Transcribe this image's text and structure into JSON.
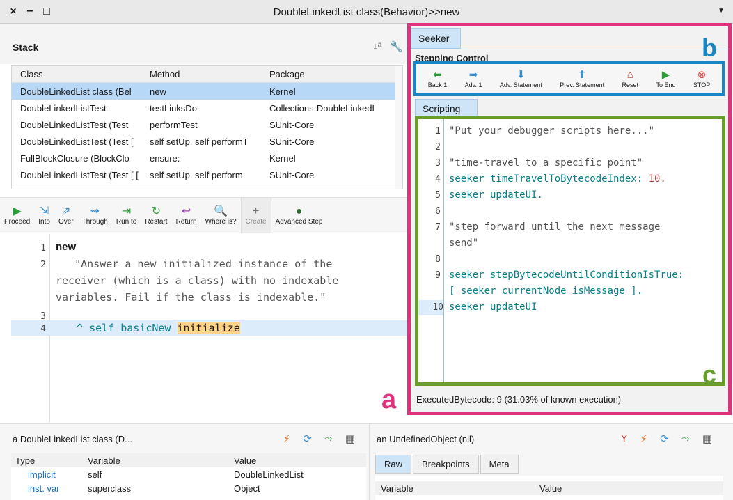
{
  "window": {
    "title": "DoubleLinkedList class(Behavior)>>new",
    "close": "×",
    "minimize": "−",
    "maximize": "□",
    "menu": "▼"
  },
  "stack": {
    "title": "Stack",
    "sort_icon": "↓ᵃ",
    "tools_icon": "🔧",
    "columns": [
      "Class",
      "Method",
      "Package"
    ],
    "rows": [
      [
        "DoubleLinkedList class (Bel",
        "new",
        "Kernel"
      ],
      [
        "DoubleLinkedListTest",
        "testLinksDo",
        "Collections-DoubleLinkedI"
      ],
      [
        "DoubleLinkedListTest (Test",
        "performTest",
        "SUnit-Core"
      ],
      [
        "DoubleLinkedListTest (Test [",
        "self setUp.   self performT",
        "SUnit-Core"
      ],
      [
        "FullBlockClosure (BlockClo",
        "ensure:",
        "Kernel"
      ],
      [
        "DoubleLinkedListTest (Test [ [",
        "self setUp.   self perform",
        "SUnit-Core"
      ]
    ]
  },
  "toolbar": [
    {
      "label": "Proceed",
      "icon": "▶",
      "color": "#2e9e3a"
    },
    {
      "label": "Into",
      "icon": "⇲",
      "color": "#3a8fd0"
    },
    {
      "label": "Over",
      "icon": "⇗",
      "color": "#3a8fd0"
    },
    {
      "label": "Through",
      "icon": "⇝",
      "color": "#3a8fd0"
    },
    {
      "label": "Run to",
      "icon": "⇥",
      "color": "#2e9e3a"
    },
    {
      "label": "Restart",
      "icon": "↻",
      "color": "#2e9e3a"
    },
    {
      "label": "Return",
      "icon": "↩",
      "color": "#9a3fb0"
    },
    {
      "label": "Where is?",
      "icon": "🔍",
      "color": "#555555"
    },
    {
      "label": "Create",
      "icon": "+",
      "color": "#777777"
    },
    {
      "label": "Advanced Step",
      "icon": "●",
      "color": "#2e6a2e"
    }
  ],
  "code": {
    "lines": [
      {
        "n": "1",
        "text": "new"
      },
      {
        "n": "2",
        "text": "   \"Answer a new initialized instance of the"
      },
      {
        "n": "",
        "text": "receiver (which is a class) with no indexable"
      },
      {
        "n": "",
        "text": "variables. Fail if the class is indexable.\""
      },
      {
        "n": "3",
        "text": ""
      },
      {
        "n": "4",
        "caret": "^",
        "pre": "self basicNew",
        "hl": "initialize"
      }
    ]
  },
  "annotations": {
    "a": "a",
    "b": "b",
    "c": "c"
  },
  "seeker": {
    "tab": "Seeker",
    "stepping_label": "Stepping Control",
    "buttons": [
      {
        "label": "Back 1",
        "icon": "⬅",
        "color": "#2e9e3a"
      },
      {
        "label": "Adv. 1",
        "icon": "➡",
        "color": "#3a8fd0"
      },
      {
        "label": "Adv. Statement",
        "icon": "⬇",
        "color": "#3a8fd0"
      },
      {
        "label": "Prev. Statement",
        "icon": "⬆",
        "color": "#3a8fd0"
      },
      {
        "label": "Reset",
        "icon": "⌂",
        "color": "#c0392b"
      },
      {
        "label": "To End",
        "icon": "▶",
        "color": "#2e9e3a"
      },
      {
        "label": "STOP",
        "icon": "⊗",
        "color": "#e53935"
      }
    ],
    "scripting_tab": "Scripting",
    "script": [
      {
        "n": "1",
        "text": "\"Put your debugger scripts here...\"",
        "cls": "cmt"
      },
      {
        "n": "2",
        "text": ""
      },
      {
        "n": "3",
        "text": "\"time-travel to a specific point\"",
        "cls": "cmt"
      },
      {
        "n": "4",
        "text": "seeker timeTravelToBytecodeIndex: ",
        "num": "10."
      },
      {
        "n": "5",
        "text": "seeker updateUI."
      },
      {
        "n": "6",
        "text": ""
      },
      {
        "n": "7",
        "text": "\"step forward until the next message",
        "cls": "cmt"
      },
      {
        "n": "",
        "text": "send\"",
        "cls": "cmt"
      },
      {
        "n": "8",
        "text": ""
      },
      {
        "n": "9",
        "text": "seeker stepBytecodeUntilConditionIsTrue:"
      },
      {
        "n": "",
        "text": "[ seeker currentNode isMessage ]."
      },
      {
        "n": "10",
        "text": "seeker updateUI",
        "hl": true
      }
    ],
    "status": "ExecutedBytecode: 9 (31.03% of known execution)"
  },
  "inspector_left": {
    "title": "a DoubleLinkedList class (D...",
    "columns": [
      "Type",
      "Variable",
      "Value"
    ],
    "rows": [
      [
        "implicit",
        "self",
        "DoubleLinkedList"
      ],
      [
        "inst. var",
        "superclass",
        "Object"
      ]
    ]
  },
  "inspector_right": {
    "title": "an UndefinedObject (nil)",
    "tabs": [
      "Raw",
      "Breakpoints",
      "Meta"
    ],
    "columns": [
      "Variable",
      "Value"
    ]
  }
}
